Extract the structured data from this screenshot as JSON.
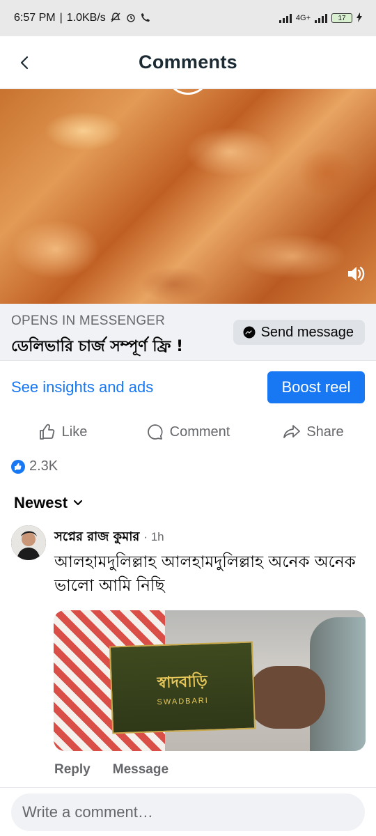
{
  "status_bar": {
    "time": "6:57 PM",
    "speed": "1.0KB/s",
    "network": "4G+",
    "battery": "17"
  },
  "header": {
    "title": "Comments"
  },
  "media": {
    "icons": [
      "back-arrow-icon",
      "sound-icon"
    ]
  },
  "cta": {
    "label": "OPENS IN MESSENGER",
    "headline": "ডেলিভারি চার্জ সম্পূর্ণ ফ্রি !",
    "send_button": "Send message"
  },
  "promo": {
    "insights_link": "See insights and ads",
    "boost_button": "Boost reel"
  },
  "actions": {
    "like": "Like",
    "comment": "Comment",
    "share": "Share"
  },
  "reactions": {
    "count": "2.3K"
  },
  "sort": {
    "label": "Newest"
  },
  "comments": [
    {
      "author": "সপ্নের রাজ কুমার",
      "time": "· 1h",
      "text": "আলহামদুলিল্লাহ আলহামদুলিল্লাহ অনেক অনেক ভালো আমি নিছি",
      "photo": {
        "brand": "স্বাদবাড়ি",
        "brand_latin": "SWADBARI"
      },
      "reply": "Reply",
      "message": "Message"
    }
  ],
  "composer": {
    "placeholder": "Write a comment…"
  },
  "colors": {
    "accent": "#1877f2",
    "secondary_text": "#65676b",
    "cta_bg": "#f0f2f5"
  }
}
